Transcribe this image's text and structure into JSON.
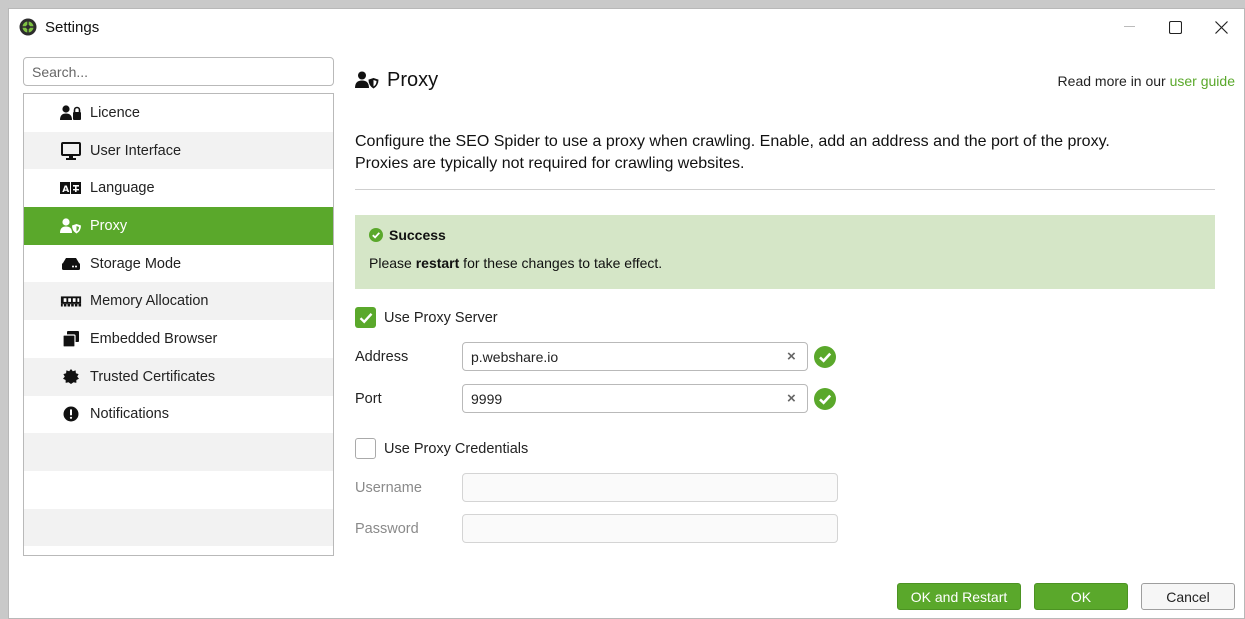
{
  "window": {
    "title": "Settings",
    "controls": {
      "minimize": "minimize-icon",
      "maximize": "maximize-icon",
      "close": "close-icon"
    }
  },
  "sidebar": {
    "search_placeholder": "Search...",
    "items": [
      {
        "label": "Licence",
        "icon": "user-lock-icon",
        "active": false
      },
      {
        "label": "User Interface",
        "icon": "monitor-icon",
        "active": false
      },
      {
        "label": "Language",
        "icon": "language-icon",
        "active": false
      },
      {
        "label": "Proxy",
        "icon": "user-shield-icon",
        "active": true
      },
      {
        "label": "Storage Mode",
        "icon": "hard-drive-icon",
        "active": false
      },
      {
        "label": "Memory Allocation",
        "icon": "memory-icon",
        "active": false
      },
      {
        "label": "Embedded Browser",
        "icon": "browser-windows-icon",
        "active": false
      },
      {
        "label": "Trusted Certificates",
        "icon": "certificate-icon",
        "active": false
      },
      {
        "label": "Notifications",
        "icon": "exclamation-circle-icon",
        "active": false
      }
    ]
  },
  "main": {
    "title": "Proxy",
    "guide_prefix": "Read more in our ",
    "guide_link": "user guide",
    "description_line1": "Configure the SEO Spider to use a proxy when crawling. Enable, add an address and the port of the proxy.",
    "description_line2": "Proxies are typically not required for crawling websites.",
    "alert": {
      "title": "Success",
      "msg_prefix": "Please ",
      "msg_bold": "restart",
      "msg_suffix": " for these changes to take effect."
    },
    "use_proxy_server": {
      "label": "Use Proxy Server",
      "checked": true
    },
    "address": {
      "label": "Address",
      "value": "p.webshare.io"
    },
    "port": {
      "label": "Port",
      "value": "9999"
    },
    "use_proxy_credentials": {
      "label": "Use Proxy Credentials",
      "checked": false
    },
    "username": {
      "label": "Username",
      "value": ""
    },
    "password": {
      "label": "Password",
      "value": ""
    }
  },
  "buttons": {
    "ok_restart": "OK and Restart",
    "ok": "OK",
    "cancel": "Cancel"
  },
  "colors": {
    "accent": "#5aa82b",
    "alert_bg": "#d5e6c7"
  }
}
